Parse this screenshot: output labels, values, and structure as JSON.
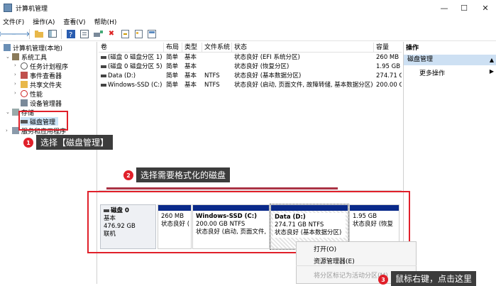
{
  "window": {
    "title": "计算机管理",
    "minimize": "—",
    "maximize": "☐",
    "close": "✕"
  },
  "menu": [
    "文件(F)",
    "操作(A)",
    "查看(V)",
    "帮助(H)"
  ],
  "toolbar_icons": [
    "back-arrow-icon",
    "forward-arrow-icon",
    "up-folder-icon",
    "show-tree-icon",
    "help-icon",
    "properties-icon",
    "connect-icon",
    "delete-icon",
    "export-icon",
    "refresh-icon",
    "view-icon"
  ],
  "tree": {
    "root": "计算机管理(本地)",
    "system_tools": "系统工具",
    "task_scheduler": "任务计划程序",
    "event_viewer": "事件查看器",
    "shared_folders": "共享文件夹",
    "performance": "性能",
    "device_manager": "设备管理器",
    "storage": "存储",
    "disk_management": "磁盘管理",
    "services": "服务和应用程序"
  },
  "volume_list": {
    "headers": [
      "卷",
      "布局",
      "类型",
      "文件系统",
      "状态",
      "容量"
    ],
    "rows": [
      [
        "(磁盘 0 磁盘分区 1)",
        "简单",
        "基本",
        "",
        "状态良好 (EFI 系统分区)",
        "260 MB"
      ],
      [
        "(磁盘 0 磁盘分区 5)",
        "简单",
        "基本",
        "",
        "状态良好 (恢复分区)",
        "1.95 GB"
      ],
      [
        "Data (D:)",
        "简单",
        "基本",
        "NTFS",
        "状态良好 (基本数据分区)",
        "274.71 G"
      ],
      [
        "Windows-SSD (C:)",
        "简单",
        "基本",
        "NTFS",
        "状态良好 (启动, 页面文件, 故障转储, 基本数据分区)",
        "200.00 G"
      ]
    ]
  },
  "actions": {
    "header": "操作",
    "selected": "磁盘管理",
    "more": "更多操作"
  },
  "disk": {
    "name": "磁盘 0",
    "type": "基本",
    "size": "476.92 GB",
    "status": "联机"
  },
  "partitions": [
    {
      "name": "",
      "size": "260 MB",
      "status": "状态良好 ("
    },
    {
      "name": "Windows-SSD (C:)",
      "size": "200.00 GB NTFS",
      "status": "状态良好 (启动, 页面文件,"
    },
    {
      "name": "Data (D:)",
      "size": "274.71 GB NTFS",
      "status": "状态良好 (基本数据分区)"
    },
    {
      "name": "",
      "size": "1.95 GB",
      "status": "状态良好 (恢复"
    }
  ],
  "context_menu": {
    "open": "打开(O)",
    "explorer": "资源管理器(E)",
    "mark_active": "将分区标记为活动分区(M)"
  },
  "callouts": {
    "step1": {
      "num": "1",
      "text": "选择【磁盘管理】"
    },
    "step2": {
      "num": "2",
      "text": "选择需要格式化的磁盘"
    },
    "step3": {
      "num": "3",
      "text": "鼠标右键，点击这里"
    }
  }
}
